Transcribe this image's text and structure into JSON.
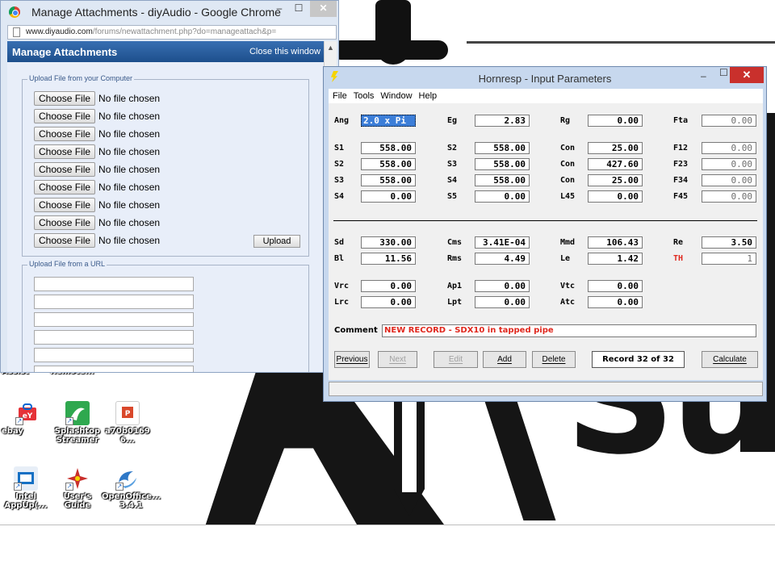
{
  "desktop": {
    "icons": [
      {
        "label": "Assist",
        "name": "assist-icon",
        "color": "#6b8fc9"
      },
      {
        "label": "Remote...",
        "name": "remote-icon",
        "color": "#8aa0c0"
      },
      {
        "label": "ebay",
        "name": "ebay-icon",
        "color": "#e53238"
      },
      {
        "label": "Splashtop Streamer",
        "name": "splashtop-icon",
        "color": "#2fa84f"
      },
      {
        "label": "a70b0169 6...",
        "name": "pdf-file-icon",
        "color": "#d9482b"
      },
      {
        "label": "Intel AppUp(...",
        "name": "intel-appup-icon",
        "color": "#1570c4"
      },
      {
        "label": "User's Guide",
        "name": "users-guide-icon",
        "color": "#c9302c"
      },
      {
        "label": "OpenOffice... 3.4.1",
        "name": "openoffice-icon",
        "color": "#2e78c7"
      }
    ]
  },
  "chrome": {
    "title": "Manage Attachments - diyAudio - Google Chrome",
    "url_host": "www.diyaudio.com",
    "url_path": "/forums/newattachment.php?do=manageattach&p=",
    "page_title": "Manage Attachments",
    "close_link": "Close this window",
    "upload_legend": "Upload File from your Computer",
    "choose_label": "Choose File",
    "no_file_label": "No file chosen",
    "upload_button": "Upload",
    "url_legend": "Upload File from a URL"
  },
  "hornresp": {
    "title": "Hornresp - Input Parameters",
    "menu": [
      "File",
      "Tools",
      "Window",
      "Help"
    ],
    "labels": {
      "ang": "Ang",
      "eg": "Eg",
      "rg": "Rg",
      "fta": "Fta",
      "s1": "S1",
      "s2a": "S2",
      "con1": "Con",
      "f12": "F12",
      "s2b": "S2",
      "s3a": "S3",
      "con2": "Con",
      "f23": "F23",
      "s3b": "S3",
      "s4a": "S4",
      "con3": "Con",
      "f34": "F34",
      "s4b": "S4",
      "s5": "S5",
      "l45": "L45",
      "f45": "F45",
      "sd": "Sd",
      "cms": "Cms",
      "mmd": "Mmd",
      "re": "Re",
      "bl": "Bl",
      "rms": "Rms",
      "le": "Le",
      "th": "TH",
      "vrc": "Vrc",
      "ap1": "Ap1",
      "vtc": "Vtc",
      "lrc": "Lrc",
      "lpt": "Lpt",
      "atc": "Atc",
      "comment": "Comment"
    },
    "values": {
      "ang": "2.0 x Pi",
      "eg": "2.83",
      "rg": "0.00",
      "fta": "0.00",
      "s1": "558.00",
      "s2a": "558.00",
      "con1": "25.00",
      "f12": "0.00",
      "s2b": "558.00",
      "s3a": "558.00",
      "con2": "427.60",
      "f23": "0.00",
      "s3b": "558.00",
      "s4a": "558.00",
      "con3": "25.00",
      "f34": "0.00",
      "s4b": "0.00",
      "s5": "0.00",
      "l45": "0.00",
      "f45": "0.00",
      "sd": "330.00",
      "cms": "3.41E-04",
      "mmd": "106.43",
      "re": "3.50",
      "bl": "11.56",
      "rms": "4.49",
      "le": "1.42",
      "th": "1",
      "vrc": "0.00",
      "ap1": "0.00",
      "vtc": "0.00",
      "lrc": "0.00",
      "lpt": "0.00",
      "atc": "0.00"
    },
    "comment": "NEW RECORD - SDX10 in tapped pipe",
    "buttons": {
      "previous": "Previous",
      "next": "Next",
      "edit": "Edit",
      "add": "Add",
      "delete": "Delete",
      "calculate": "Calculate"
    },
    "record": "Record 32 of 32",
    "colors": {
      "title_bg": "#c7d8ee",
      "close": "#c9302c",
      "highlight": "#3c7ed8",
      "red_text": "#e0281e"
    }
  },
  "wallpaper": {
    "letters": "Sur"
  }
}
